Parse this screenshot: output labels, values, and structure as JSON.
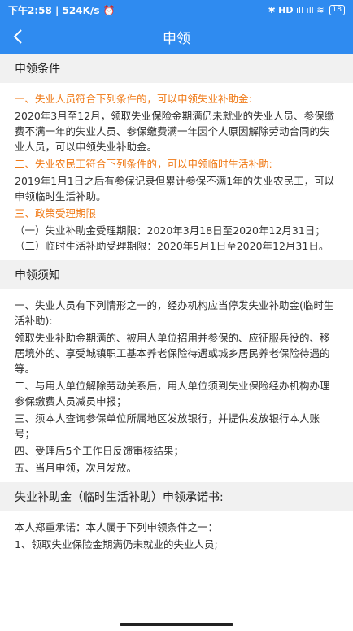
{
  "status": {
    "time_speed": "下午2:58 | 524K/s ⏰",
    "signals": "✱ 𝗛𝗗 ıll ıll ≋",
    "battery": "18"
  },
  "header": {
    "title": "申领"
  },
  "section1": {
    "title": "申领条件",
    "h1": "一、失业人员符合下列条件的，可以申领失业补助金:",
    "p1": "2020年3月至12月，领取失业保险金期满仍未就业的失业人员、参保缴费不满一年的失业人员、参保缴费满一年因个人原因解除劳动合同的失业人员，可以申领失业补助金。",
    "h2": "二、失业农民工符合下列条件的，可以申领临时生活补助:",
    "p2": "2019年1月1日之后有参保记录但累计参保不满1年的失业农民工，可以申领临时生活补助。",
    "h3": "三、政策受理期限",
    "p3": "（一）失业补助金受理期限：2020年3月18日至2020年12月31日；（二）临时生活补助受理期限：2020年5月1日至2020年12月31日。"
  },
  "section2": {
    "title": "申领须知",
    "p1": "一、失业人员有下列情形之一的，经办机构应当停发失业补助金(临时生活补助):",
    "p2": "领取失业补助金期满的、被用人单位招用并参保的、应征服兵役的、移居境外的、享受城镇职工基本养老保险待遇或城乡居民养老保险待遇的等。",
    "p3": "二、与用人单位解除劳动关系后，用人单位须到失业保险经办机构办理参保缴费人员减员申报；",
    "p4": "三、须本人查询参保单位所属地区发放银行，并提供发放银行本人账号；",
    "p5": "四、受理后5个工作日反馈审核结果；",
    "p6": "五、当月申领，次月发放。"
  },
  "section3": {
    "title": "失业补助金（临时生活补助）申领承诺书:",
    "p1": "本人郑重承诺：本人属于下列申领条件之一：",
    "p2": "1、领取失业保险金期满仍未就业的失业人员;"
  }
}
